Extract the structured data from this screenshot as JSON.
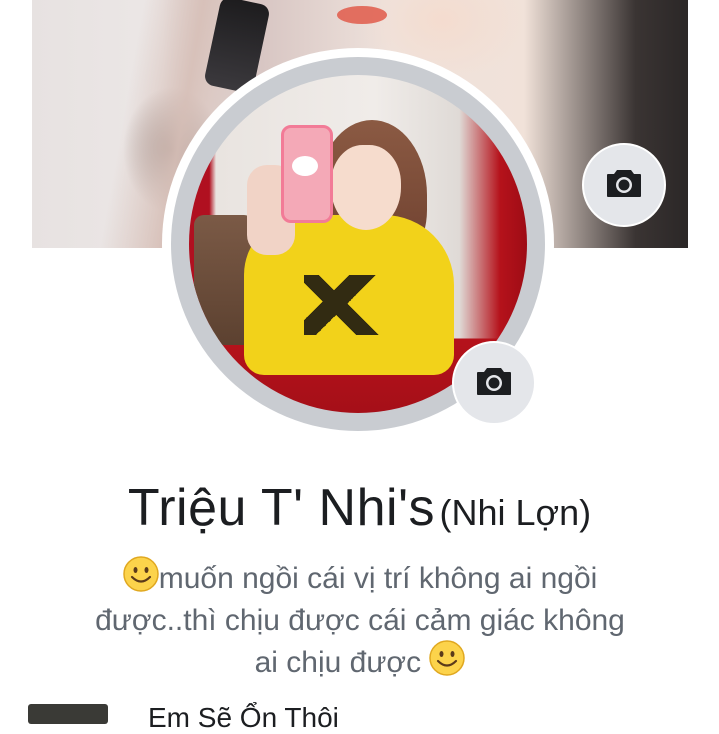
{
  "profile": {
    "name": "Triệu T' Nhi's",
    "alternate_name": "(Nhi Lợn)",
    "bio_line1": "muốn ngồi cái vị trí không ai ngồi",
    "bio_line2": "được..thì chịu được cái cảm giác không",
    "bio_line3": "ai chịu được "
  },
  "icons": {
    "cover_camera": "camera-icon",
    "avatar_camera": "camera-icon",
    "smiley": "smiley-icon"
  },
  "next_item": {
    "label": "Em Sẽ Ổn Thôi"
  },
  "colors": {
    "name_text": "#1c1e21",
    "bio_text": "#606770",
    "camera_button_bg": "#e4e6ea",
    "avatar_ring": "#c9ccd1"
  }
}
